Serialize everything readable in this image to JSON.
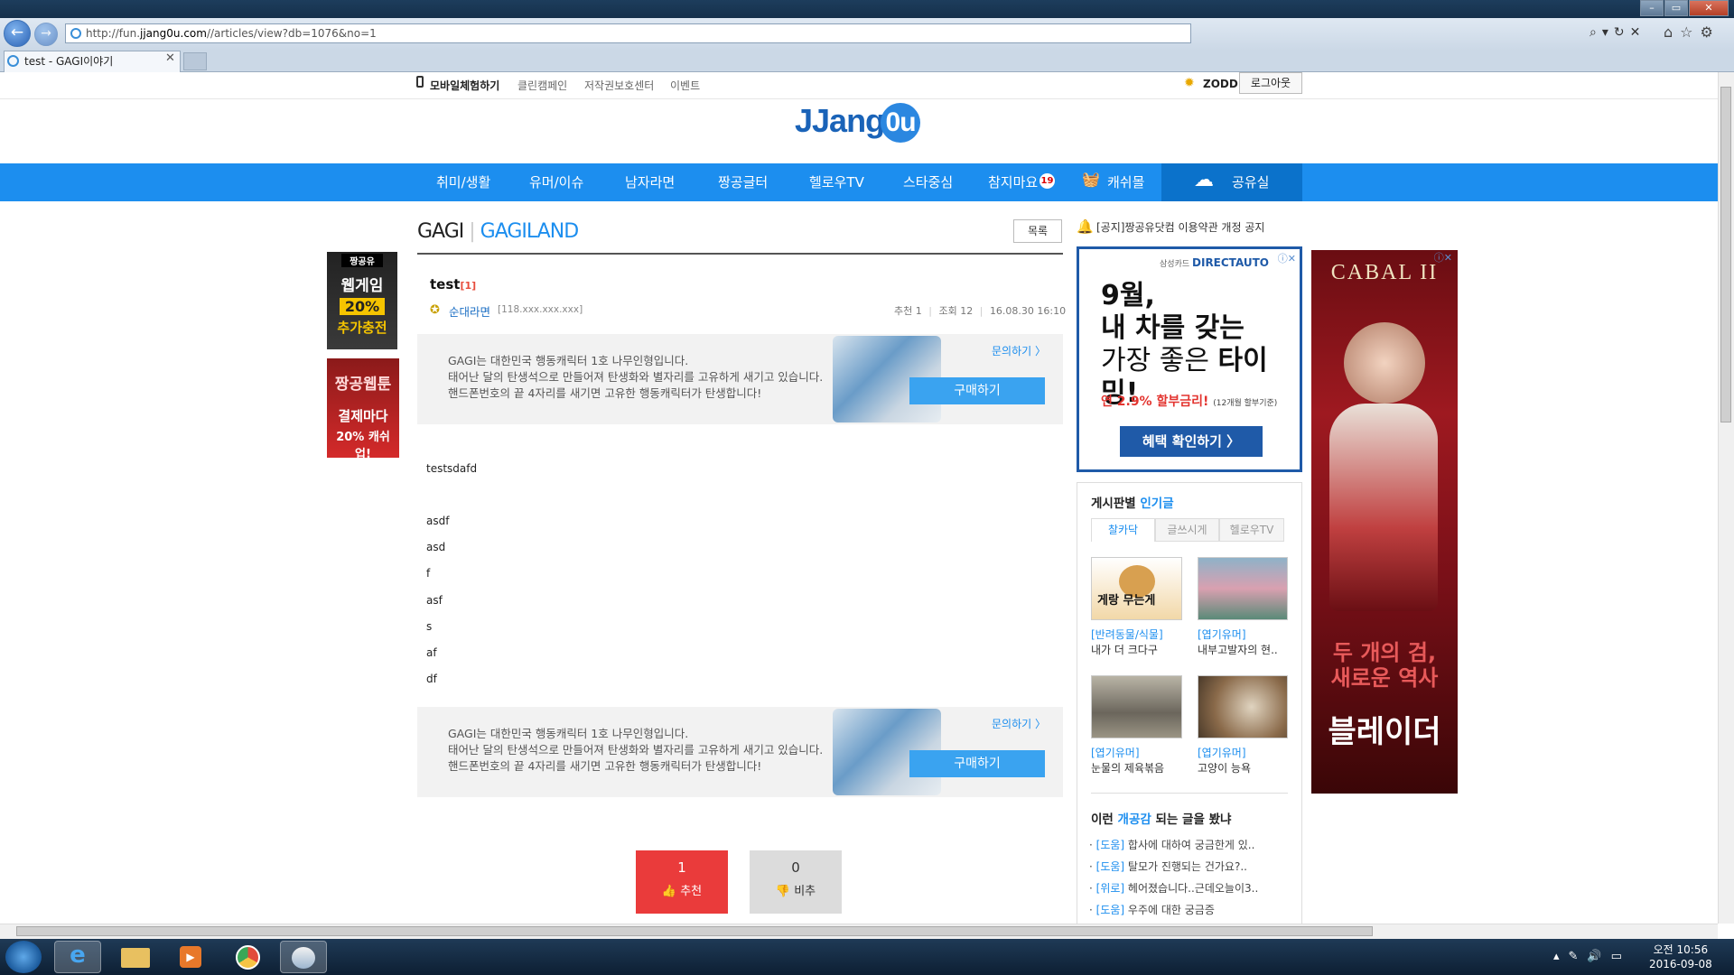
{
  "browser": {
    "url_prefix": "http://fun.",
    "url_domain": "jjang0u.com",
    "url_path": "//articles/view?db=1076&no=1",
    "tab_title": "test - GAGI이야기",
    "window_buttons": [
      "–",
      "▭",
      "✕"
    ],
    "addr_tools": "⌕▾↻✕",
    "right_tools": "⌂☆⚙"
  },
  "util": {
    "mobile": "모바일체험하기",
    "clean": "클린캠페인",
    "copyright": "저작권보호센터",
    "event": "이벤트",
    "user": "ZODD",
    "logout": "로그아웃"
  },
  "logo": {
    "text": "JJang",
    "u": "0u"
  },
  "nav": {
    "items": [
      "취미/생활",
      "유머/이슈",
      "남자라면",
      "짱공글터",
      "헬로우TV",
      "스타중심",
      "참지마요"
    ],
    "badge": "19",
    "shop": "캐쉬몰",
    "share": "공유실"
  },
  "left_ads": {
    "ad1_top": "짱공유",
    "ad1_mid": "웹게임",
    "ad1_pct": "20%",
    "ad1_bottom": "추가충전",
    "ad2_top": "짱공웹툰",
    "ad2_mid": "결제마다",
    "ad2_bottom": "20% 캐쉬 업!"
  },
  "board": {
    "name1": "GAGI",
    "name2": "GAGILAND",
    "list": "목록"
  },
  "post": {
    "title": "test",
    "comment_count": "[1]",
    "author": "순대라면",
    "ip": "[118.xxx.xxx.xxx]",
    "rec_label": "추천",
    "rec": "1",
    "views_label": "조회",
    "views": "12",
    "date": "16.08.30 16:10",
    "body": [
      "testsdafd",
      "asdf",
      "asd",
      "f",
      "asf",
      "s",
      "af",
      "df"
    ]
  },
  "promo": {
    "line1": "GAGI는 대한민국 행동캐릭터 1호 나무인형입니다.",
    "line2": "태어난 달의 탄생석으로 만들어져 탄생화와 별자리를 고유하게 새기고 있습니다.",
    "line3": "핸드폰번호의 끝 4자리를 새기면 고유한 행동캐릭터가 탄생합니다!",
    "ask": "문의하기 〉",
    "buy": "구매하기"
  },
  "vote": {
    "up_count": "1",
    "up_label": "추천",
    "down_count": "0",
    "down_label": "비추"
  },
  "notice": "[공지]짱공유닷컴 이용약관 개정 공지",
  "ad_direct": {
    "brand_small": "삼성카드",
    "brand": "DIRECTAUTO",
    "line1": "9월,",
    "line2": "내 차를 갖는",
    "line3a": "가장 좋은 ",
    "line3b": "타이밍!",
    "rate": "연 2.9% 할부금리!",
    "rate_note": "(12개월 할부기준)",
    "cta": "혜택 확인하기 〉"
  },
  "ad_cabal": {
    "logo": "CABAL II",
    "line1": "두 개의 검,",
    "line2": "새로운 역사",
    "line3": "블레이더"
  },
  "popular": {
    "title1": "게시판별 ",
    "title2": "인기글",
    "tabs": [
      "찰카닥",
      "글쓰시게",
      "헬로우TV"
    ],
    "thumb_text": "게랑 무는게",
    "items": [
      {
        "cat": "[반려동물/식물]",
        "title": "내가 더 크다구"
      },
      {
        "cat": "[엽기유머]",
        "title": "내부고발자의 현.."
      },
      {
        "cat": "[엽기유머]",
        "title": "눈물의 제육볶음"
      },
      {
        "cat": "[엽기유머]",
        "title": "고양이 능욕"
      }
    ]
  },
  "related": {
    "title1": "이런 ",
    "title2": "개공감",
    "title3": " 되는 글을 봤냐",
    "items": [
      {
        "cat": "[도움]",
        "title": "합사에 대하여 궁금한게 있.."
      },
      {
        "cat": "[도움]",
        "title": "탈모가 진행되는 건가요?.."
      },
      {
        "cat": "[위로]",
        "title": "헤어졌습니다..근데오늘이3.."
      },
      {
        "cat": "[도움]",
        "title": "우주에 대한 궁금증"
      }
    ]
  },
  "taskbar": {
    "time_ampm": "오전 10:56",
    "date": "2016-09-08"
  }
}
